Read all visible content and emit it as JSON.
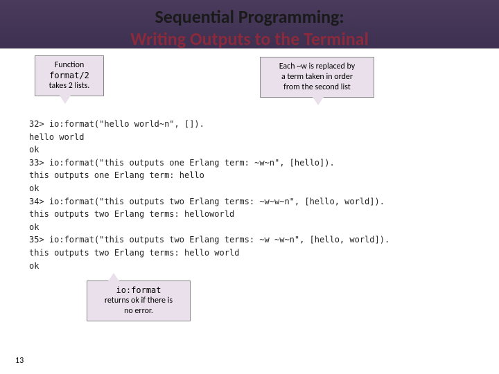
{
  "header": {
    "line1": "Sequential Programming:",
    "line2": "Writing Outputs to the Terminal"
  },
  "callouts": {
    "c1_l1": "Function",
    "c1_l2": "format/2",
    "c1_l3": "takes 2 lists.",
    "c2_l1": "Each ~w is replaced by",
    "c2_l2": "a term taken in order",
    "c2_l3": "from the second list",
    "c3_l1": "io:format",
    "c3_l2": "returns ok if there is",
    "c3_l3": "no error."
  },
  "code": {
    "l1": "32> io:format(\"hello world~n\", []).",
    "l2": "hello world",
    "l3": "ok",
    "l4": "33> io:format(\"this outputs one Erlang term: ~w~n\", [hello]).",
    "l5": "this outputs one Erlang term: hello",
    "l6": "ok",
    "l7": "34> io:format(\"this outputs two Erlang terms: ~w~w~n\", [hello, world]).",
    "l8": "this outputs two Erlang terms: helloworld",
    "l9": "ok",
    "l10": "35> io:format(\"this outputs two Erlang terms: ~w ~w~n\", [hello, world]).",
    "l11": "this outputs two Erlang terms: hello world",
    "l12": "ok"
  },
  "page_number": "13"
}
